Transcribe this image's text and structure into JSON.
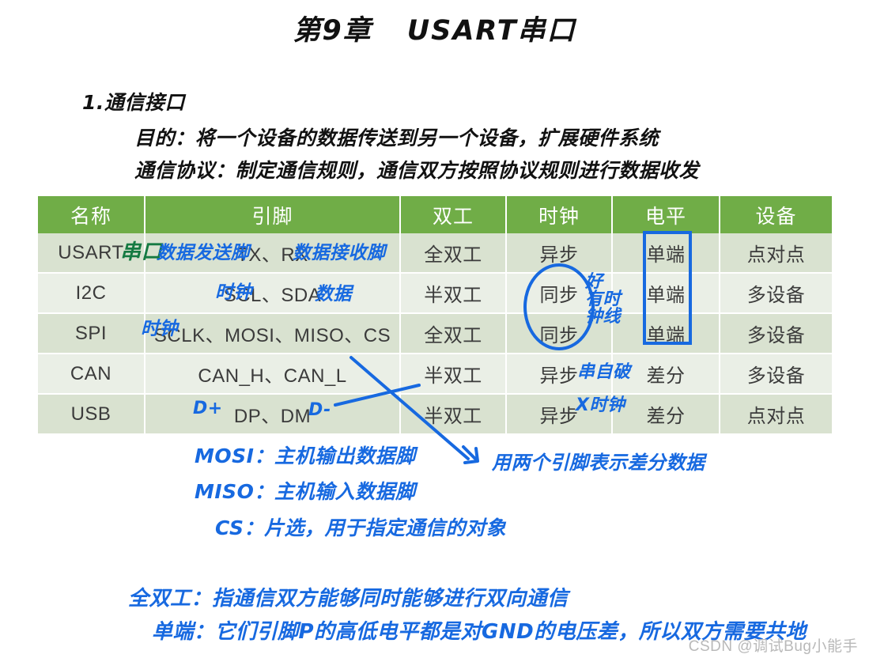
{
  "title": {
    "chapter": "第9章",
    "subject": "USART串口"
  },
  "notes_top": {
    "heading": "1.通信接口",
    "purpose": "目的：将一个设备的数据传送到另一个设备，扩展硬件系统",
    "protocol": "通信协议：制定通信规则，通信双方按照协议规则进行数据收发"
  },
  "table": {
    "headers": [
      "名称",
      "引脚",
      "双工",
      "时钟",
      "电平",
      "设备"
    ],
    "rows": [
      [
        "USART",
        "TX、RX",
        "全双工",
        "异步",
        "单端",
        "点对点"
      ],
      [
        "I2C",
        "SCL、SDA",
        "半双工",
        "同步",
        "单端",
        "多设备"
      ],
      [
        "SPI",
        "SCLK、MOSI、MISO、CS",
        "全双工",
        "同步",
        "单端",
        "多设备"
      ],
      [
        "CAN",
        "CAN_H、CAN_L",
        "半双工",
        "异步",
        "差分",
        "多设备"
      ],
      [
        "USB",
        "DP、DM",
        "半双工",
        "异步",
        "差分",
        "点对点"
      ]
    ]
  },
  "annotations": {
    "usart_serial": "串口",
    "tx_label": "数据发送脚",
    "rx_label": "数据接收脚",
    "i2c_clock": "时钟",
    "i2c_data": "数据",
    "spi_clock": "时钟",
    "usb_dplus": "D+",
    "usb_dminus": "D-",
    "clock_good_1": "好",
    "clock_good_2": "有时",
    "clock_good_3": "钟线",
    "can_async": "串自破",
    "usb_no_clock": "X时钟"
  },
  "notes_bottom": {
    "mosi": "MOSI：主机输出数据脚",
    "miso": "MISO：主机输入数据脚",
    "cs": "CS：片选，用于指定通信的对象",
    "differential": "用两个引脚表示差分数据",
    "full_duplex": "全双工：指通信双方能够同时能够进行双向通信",
    "single_ended": "单端：它们引脚P的高低电平都是对GND的电压差，所以双方需要共地"
  },
  "watermark": "CSDN @调试Bug小能手",
  "colors": {
    "header_green": "#70ad47",
    "row_dark": "#d9e2d0",
    "row_light": "#eaefe6",
    "ink_blue": "#1769e0",
    "ink_green": "#157a42",
    "ink_black": "#111111",
    "watermark_gray": "#b9b9b9"
  }
}
